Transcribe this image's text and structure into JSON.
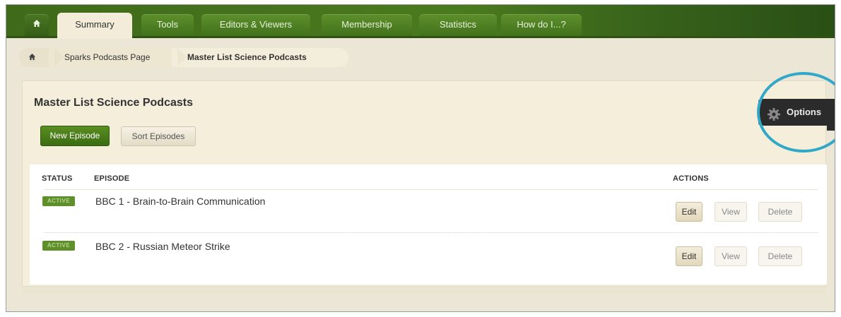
{
  "nav": {
    "home_icon": "home-icon",
    "tabs": [
      {
        "label": "Summary",
        "active": true
      },
      {
        "label": "Tools",
        "active": false
      },
      {
        "label": "Editors & Viewers",
        "active": false
      },
      {
        "label": "Membership",
        "active": false
      },
      {
        "label": "Statistics",
        "active": false
      },
      {
        "label": "How do I...?",
        "active": false
      }
    ]
  },
  "breadcrumb": {
    "home_icon": "home-icon",
    "items": [
      "Sparks Podcasts Page",
      "Master List Science Podcasts"
    ]
  },
  "page": {
    "title": "Master List Science Podcasts",
    "new_episode_label": "New Episode",
    "sort_episodes_label": "Sort Episodes",
    "options_label": "Options",
    "options_icon": "gear-icon"
  },
  "table": {
    "headers": {
      "status": "STATUS",
      "episode": "EPISODE",
      "actions": "ACTIONS"
    },
    "rows": [
      {
        "status": "ACTIVE",
        "episode": "BBC 1 - Brain-to-Brain Communication",
        "edit": "Edit",
        "view": "View",
        "delete": "Delete"
      },
      {
        "status": "ACTIVE",
        "episode": "BBC 2 - Russian Meteor Strike",
        "edit": "Edit",
        "view": "View",
        "delete": "Delete"
      }
    ]
  },
  "colors": {
    "nav_green": "#4a7a1f",
    "button_green": "#4a7d1a",
    "panel_beige": "#f4eedb",
    "highlight_circle": "#31a8c8"
  }
}
